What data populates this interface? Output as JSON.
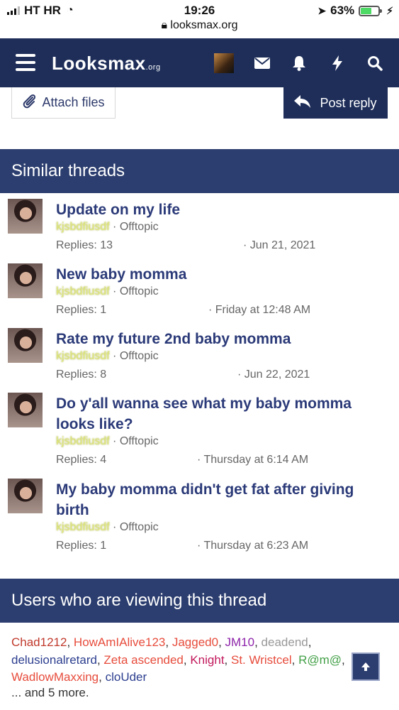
{
  "status_bar": {
    "carrier": "HT HR",
    "time": "19:26",
    "url": "looksmax.org",
    "battery": "63%"
  },
  "nav": {
    "logo_main": "Looksmax",
    "logo_suffix": ".org"
  },
  "actions": {
    "attach_label": "Attach files",
    "post_reply_label": "Post reply"
  },
  "similar": {
    "header": "Similar threads",
    "threads": [
      {
        "title": "Update on my life",
        "author": "kjsbdfiusdf",
        "forum": "Offtopic",
        "replies": "Replies: 13",
        "date": "Jun 21, 2021"
      },
      {
        "title": "New baby momma",
        "author": "kjsbdfiusdf",
        "forum": "Offtopic",
        "replies": "Replies: 1",
        "date": "Friday at 12:48 AM"
      },
      {
        "title": "Rate my future 2nd baby momma",
        "author": "kjsbdfiusdf",
        "forum": "Offtopic",
        "replies": "Replies: 8",
        "date": "Jun 22, 2021"
      },
      {
        "title": "Do y'all wanna see what my baby momma looks like?",
        "author": "kjsbdfiusdf",
        "forum": "Offtopic",
        "replies": "Replies: 4",
        "date": "Thursday at 6:14 AM"
      },
      {
        "title": "My baby momma didn't get fat after giving birth",
        "author": "kjsbdfiusdf",
        "forum": "Offtopic",
        "replies": "Replies: 1",
        "date": "Thursday at 6:23 AM"
      }
    ]
  },
  "viewers": {
    "header": "Users who are viewing this thread",
    "users": [
      {
        "name": "Chad1212",
        "color": "#c0392b"
      },
      {
        "name": "HowAmIAlive123",
        "color": "#e74c3c"
      },
      {
        "name": "Jagged0",
        "color": "#e74c3c"
      },
      {
        "name": "JM10",
        "color": "#8e24aa"
      },
      {
        "name": "deadend",
        "color": "#999999"
      },
      {
        "name": "delusionalretard",
        "color": "#2c3e8f"
      },
      {
        "name": "Zeta ascended",
        "color": "#e74c3c"
      },
      {
        "name": "Knight",
        "color": "#c2185b"
      },
      {
        "name": "St. Wristcel",
        "color": "#e74c3c"
      },
      {
        "name": "R@m@",
        "color": "#43a047"
      },
      {
        "name": "WadlowMaxxing",
        "color": "#e74c3c"
      },
      {
        "name": "cloUder",
        "color": "#2c3e8f"
      }
    ],
    "more": "... and 5 more."
  }
}
